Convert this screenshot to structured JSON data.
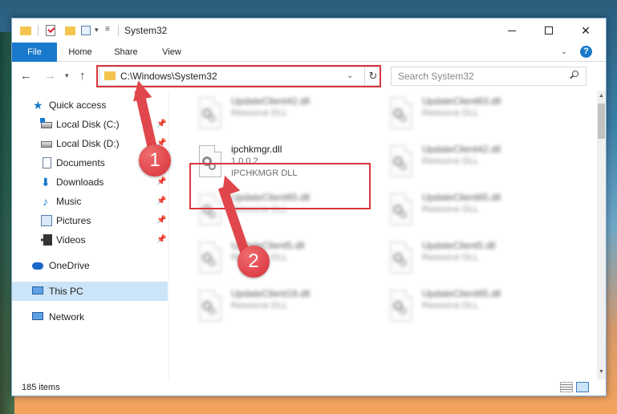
{
  "window": {
    "title": "System32",
    "controls": {
      "minimize": "—",
      "maximize": "□",
      "close": "✕"
    }
  },
  "ribbon": {
    "tabs": [
      "File",
      "Home",
      "Share",
      "View"
    ],
    "help": "?"
  },
  "address_bar": {
    "path": "C:\\Windows\\System32",
    "refresh": "↻",
    "dropdown": "⌄"
  },
  "search": {
    "placeholder": "Search System32"
  },
  "nav_pane": {
    "items": [
      {
        "label": "Quick access",
        "icon": "star-icon",
        "pinned": false
      },
      {
        "label": "Local Disk (C:)",
        "icon": "drive-c-icon",
        "pinned": true
      },
      {
        "label": "Local Disk (D:)",
        "icon": "drive-icon",
        "pinned": true
      },
      {
        "label": "Documents",
        "icon": "documents-icon",
        "pinned": true
      },
      {
        "label": "Downloads",
        "icon": "downloads-icon",
        "pinned": true
      },
      {
        "label": "Music",
        "icon": "music-icon",
        "pinned": true
      },
      {
        "label": "Pictures",
        "icon": "pictures-icon",
        "pinned": true
      },
      {
        "label": "Videos",
        "icon": "videos-icon",
        "pinned": true
      },
      {
        "label": "OneDrive",
        "icon": "onedrive-icon",
        "pinned": false
      },
      {
        "label": "This PC",
        "icon": "this-pc-icon",
        "pinned": false,
        "selected": true
      },
      {
        "label": "Network",
        "icon": "network-icon",
        "pinned": false
      }
    ]
  },
  "files": {
    "left": [
      {
        "name": "UpdateClient42.dll",
        "sub": "Resource DLL",
        "blurred": true
      },
      {
        "name": "ipchkmgr.dll",
        "sub": "1.0.0.2",
        "sub2": "IPCHKMGR DLL",
        "blurred": false
      },
      {
        "name": "UpdateClient65.dll",
        "sub": "Resource DLL",
        "blurred": true
      },
      {
        "name": "UpdateClient5.dll",
        "sub": "Resource DLL",
        "blurred": true
      },
      {
        "name": "UpdateClient19.dll",
        "sub": "Resource DLL",
        "blurred": true
      }
    ],
    "right": [
      {
        "name": "UpdateClient63.dll",
        "sub": "Resource DLL",
        "blurred": true
      },
      {
        "name": "UpdateClient42.dll",
        "sub": "Resource DLL",
        "blurred": true
      },
      {
        "name": "UpdateClient65.dll",
        "sub": "Resource DLL",
        "blurred": true
      },
      {
        "name": "UpdateClient5.dll",
        "sub": "Resource DLL",
        "blurred": true
      },
      {
        "name": "UpdateClient65.dll",
        "sub": "Resource DLL",
        "blurred": true
      }
    ]
  },
  "status": {
    "items": "185 items"
  },
  "callouts": [
    "1",
    "2"
  ],
  "colors": {
    "accent": "#1979ca",
    "callout": "#d9363e",
    "selection": "#cce4f7"
  }
}
